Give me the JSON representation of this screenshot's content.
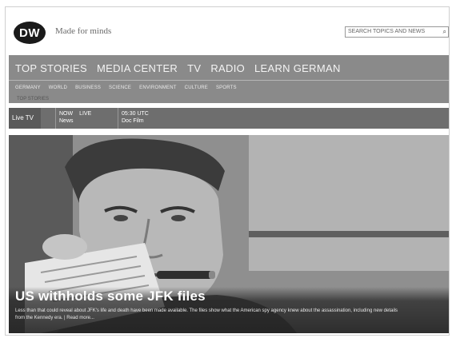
{
  "header": {
    "logo_text": "DW",
    "tagline": "Made for minds",
    "search_placeholder": "SEARCH TOPICS AND NEWS",
    "search_icon": "magnifier-icon"
  },
  "main_nav": {
    "items": [
      "TOP STORIES",
      "MEDIA CENTER",
      "TV",
      "RADIO",
      "LEARN GERMAN"
    ]
  },
  "sub_nav": {
    "items": [
      "GERMANY",
      "WORLD",
      "BUSINESS",
      "SCIENCE",
      "ENVIRONMENT",
      "CULTURE",
      "SPORTS"
    ]
  },
  "breadcrumb": "TOP STORIES",
  "live_bar": {
    "live_tv": "Live TV",
    "tile_a": {
      "line1": "NOW",
      "line2": "LIVE",
      "line3": "News"
    },
    "tile_b": {
      "line1": "05:30 UTC",
      "line2": "Doc Film"
    }
  },
  "hero": {
    "title": "US withholds some JFK files",
    "summary": "Less than that could reveal about JFK's life and death have been made available. The files show what the American spy agency knew about the assassination, including new details from the Kennedy era. | Read more..."
  }
}
